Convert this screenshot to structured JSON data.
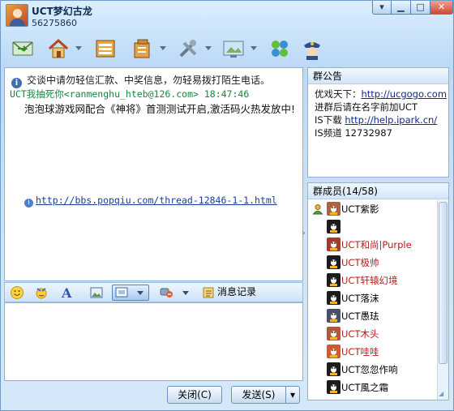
{
  "window": {
    "group_name": "UCT梦幻古龙",
    "group_id": "56275860",
    "controls": {
      "settings": "▾",
      "minimize": "▁",
      "maximize": "□",
      "close": "✕"
    }
  },
  "toolbar": {
    "icons": [
      "mail-icon",
      "home-icon",
      "space-icon",
      "share-icon",
      "apps-icon",
      "display-icon",
      "puzzle-icon",
      "police-icon"
    ]
  },
  "chat": {
    "notice": "交谈中请勿轻信汇款、中奖信息，勿轻易拨打陌生电话。",
    "notice_icon": "i",
    "message": {
      "sender_line": "UCT我抽死你<ranmenghu_hteb@126.com>  18:47:46",
      "body": "泡泡球游戏网配合《神将》首测测试开启,激活码火热发放中!",
      "link_icon": "i",
      "link": "http://bbs.popqiu.com/thread-12846-1-1.html"
    }
  },
  "input_toolbar": {
    "history_label": "消息记录"
  },
  "buttons": {
    "close": "关闭(C)",
    "send": "发送(S)",
    "send_dropdown": "▾"
  },
  "collapse_arrow": "›",
  "announcement": {
    "title": "群公告",
    "line1_prefix": "优戏天下：",
    "line1_link": "http://ucgogo.com",
    "line2": "进群后请在名字前加UCT",
    "line3_prefix": "IS下载 ",
    "line3_link": "http://help.ipark.cn/",
    "line4": "IS频道 12732987"
  },
  "members": {
    "title": "群成员(14/58)",
    "list": [
      {
        "name": "UCT紫影",
        "color": "#000000",
        "face": "#b0603a"
      },
      {
        "name": "",
        "color": "#000000",
        "face": "#1c1c1c"
      },
      {
        "name": "UCT和尚|Purple",
        "color": "#c0181a",
        "face": "#a23b2a"
      },
      {
        "name": "UCT极帅",
        "color": "#c0181a",
        "face": "#1c1c1c"
      },
      {
        "name": "UCT轩辕幻境",
        "color": "#c0181a",
        "face": "#1c1c1c"
      },
      {
        "name": "UCT落沫",
        "color": "#000000",
        "face": "#1c1c1c"
      },
      {
        "name": "UCT愚珐",
        "color": "#000000",
        "face": "#4a4f6e"
      },
      {
        "name": "UCT木头",
        "color": "#c0181a",
        "face": "#b3563a"
      },
      {
        "name": "UCT哇哇",
        "color": "#c0181a",
        "face": "#d45a2e"
      },
      {
        "name": "UCT忽忽作响",
        "color": "#000000",
        "face": "#1c1c1c"
      },
      {
        "name": "UCT風之霜",
        "color": "#000000",
        "face": "#1c1c1c"
      }
    ]
  }
}
